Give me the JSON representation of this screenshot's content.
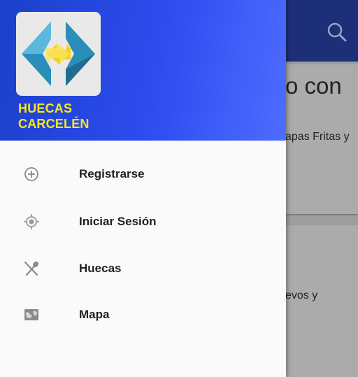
{
  "background": {
    "card1": {
      "title": "o con",
      "text": "apas Fritas y"
    },
    "card2": {
      "text": "evos y"
    }
  },
  "drawer": {
    "brand_line1": "HUECAS",
    "brand_line2": "CARCELÉN",
    "items": [
      {
        "label": "Registrarse",
        "icon": "add-circle-icon"
      },
      {
        "label": "Iniciar Sesión",
        "icon": "location-target-icon"
      },
      {
        "label": "Huecas",
        "icon": "utensils-icon"
      },
      {
        "label": "Mapa",
        "icon": "map-icon"
      }
    ]
  },
  "colors": {
    "app_bar": "#1d2f79",
    "drawer_header_start": "#1b40c9",
    "drawer_header_end": "#4e6cff",
    "brand_text": "#ffe812"
  }
}
